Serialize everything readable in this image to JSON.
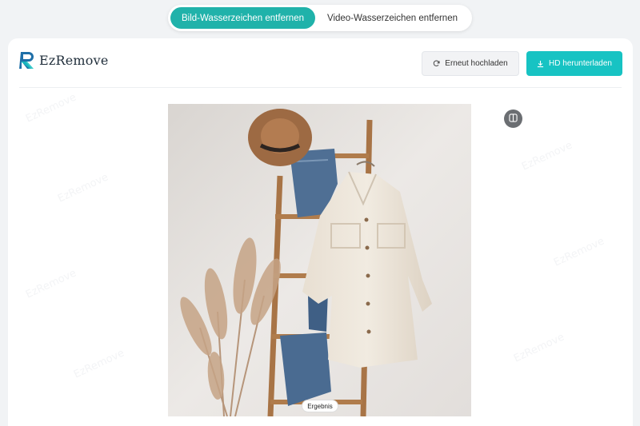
{
  "tabs": [
    {
      "label": "Bild-Wasserzeichen entfernen",
      "active": true
    },
    {
      "label": "Video-Wasserzeichen entfernen",
      "active": false
    }
  ],
  "logo": {
    "text": "EzRemove"
  },
  "actions": {
    "reupload_label": "Erneut hochladen",
    "download_label": "HD herunterladen"
  },
  "image": {
    "badge": "Ergebnis"
  },
  "colors": {
    "accent": "#17c3c3",
    "tab_active": "#20b2aa"
  },
  "icons": [
    "refresh-icon",
    "download-icon",
    "compare-icon"
  ]
}
